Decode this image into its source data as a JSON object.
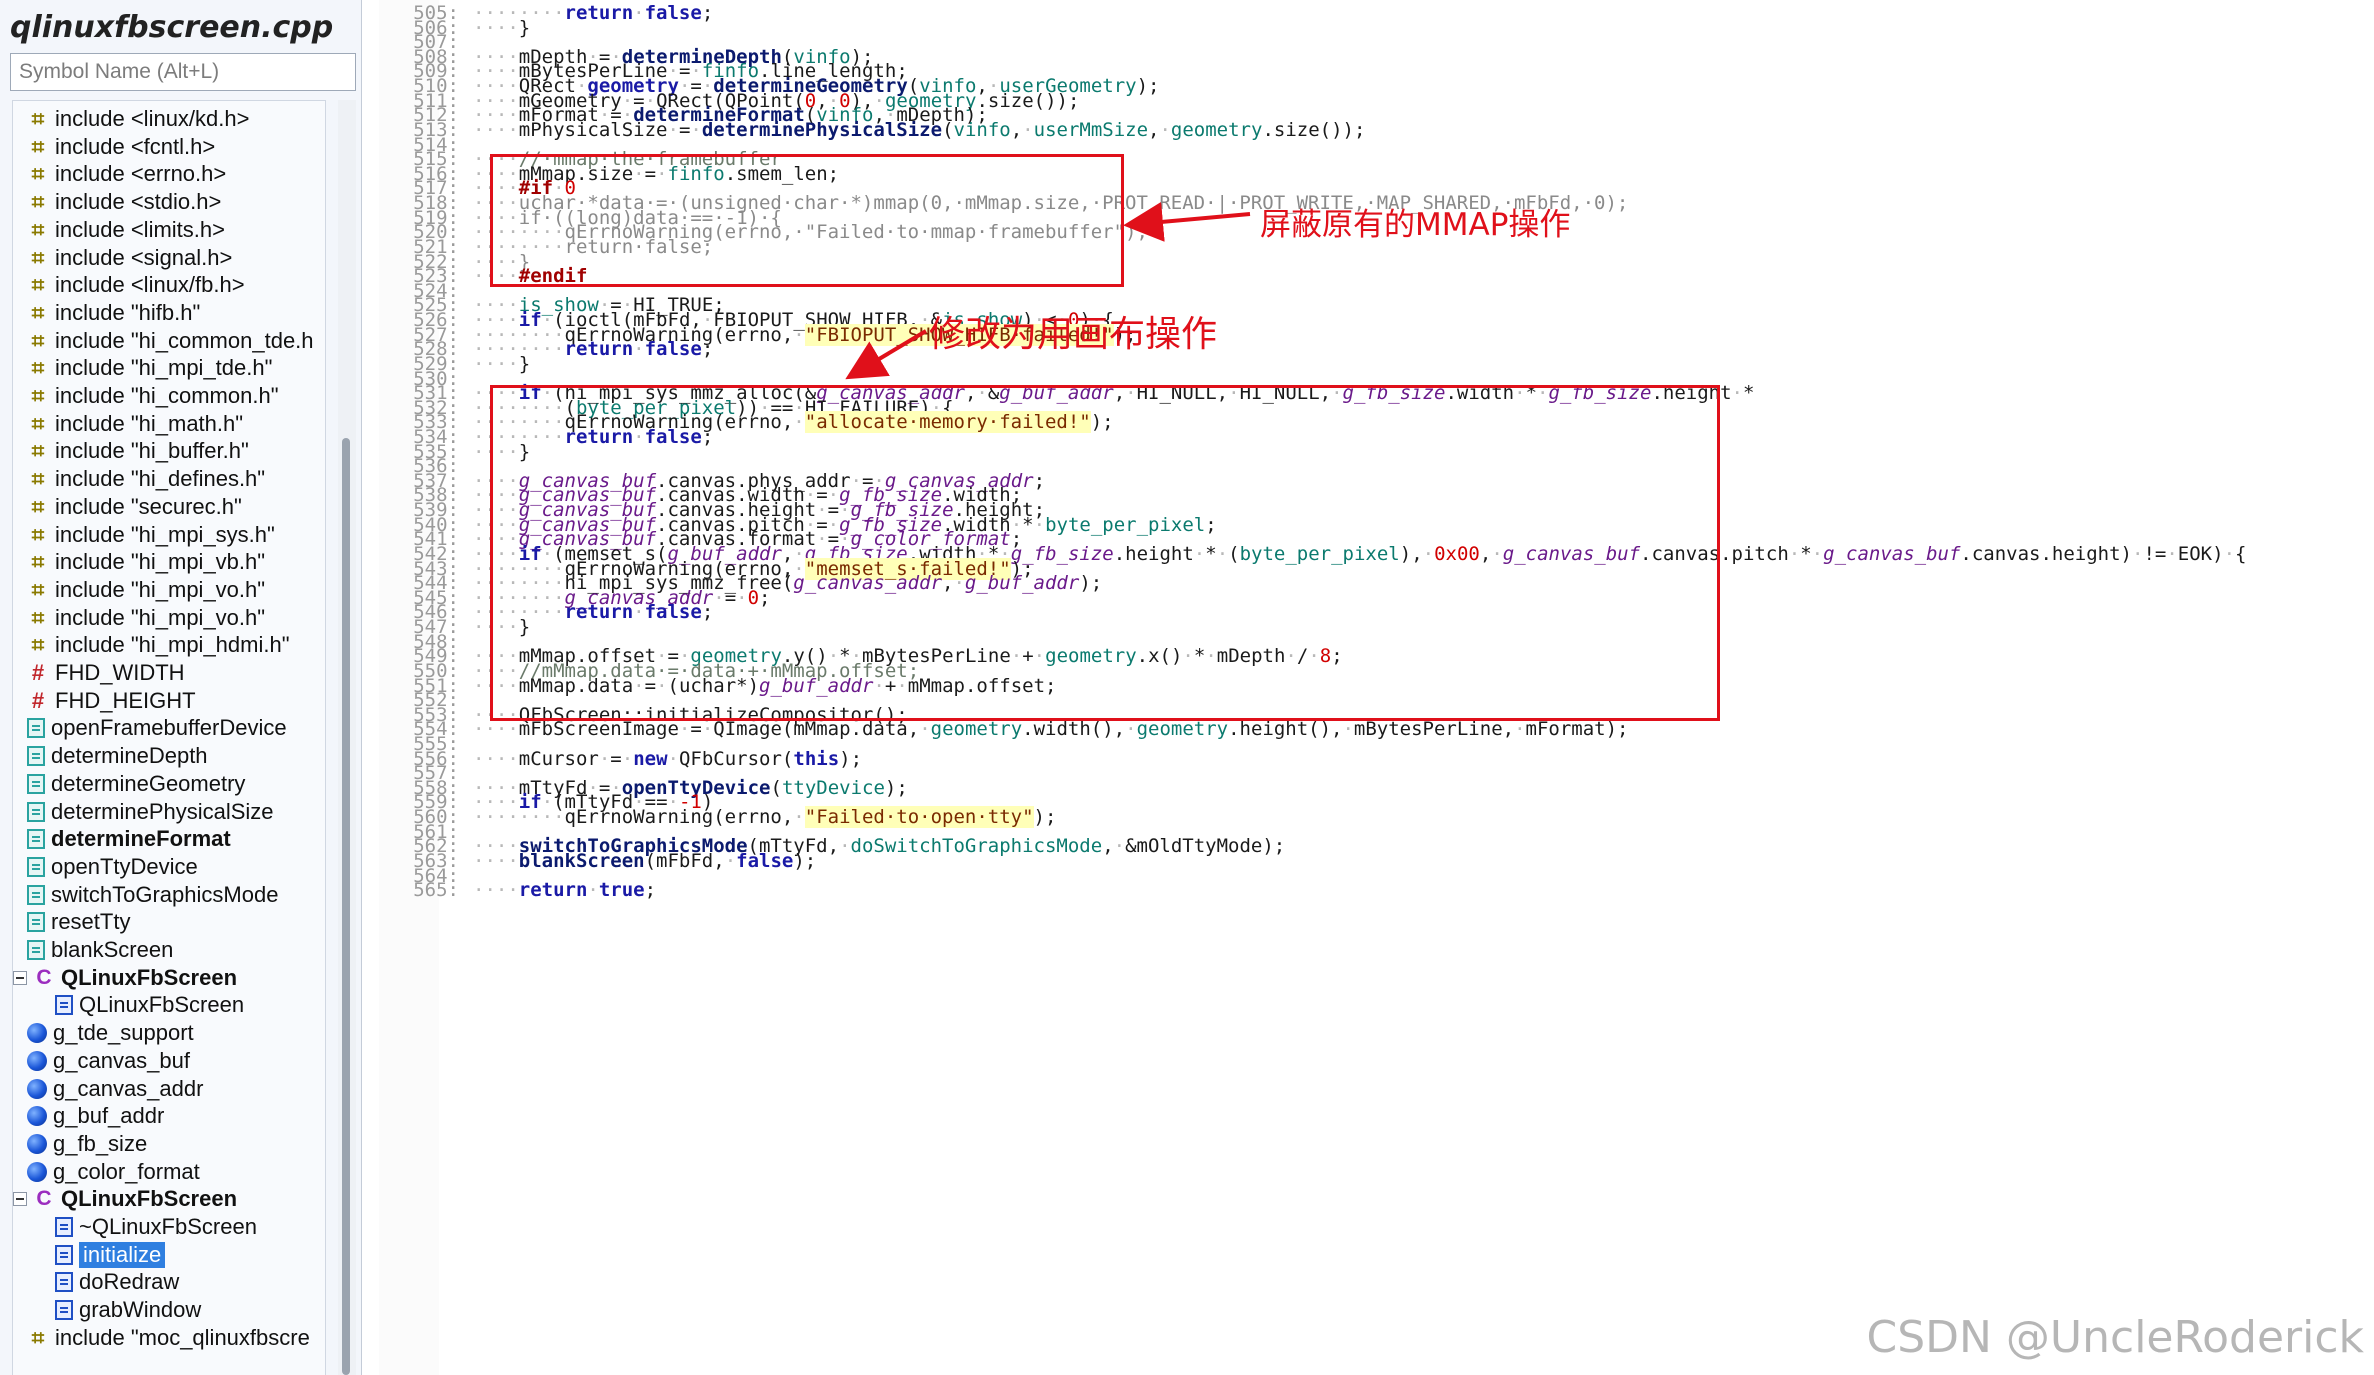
{
  "sidebar": {
    "file_title": "qlinuxfbscreen.cpp",
    "search_placeholder": "Symbol Name (Alt+L)",
    "items": [
      {
        "label": "include <linux/kd.h>",
        "kind": "include",
        "indent": 1
      },
      {
        "label": "include <fcntl.h>",
        "kind": "include",
        "indent": 1
      },
      {
        "label": "include <errno.h>",
        "kind": "include",
        "indent": 1
      },
      {
        "label": "include <stdio.h>",
        "kind": "include",
        "indent": 1
      },
      {
        "label": "include <limits.h>",
        "kind": "include",
        "indent": 1
      },
      {
        "label": "include <signal.h>",
        "kind": "include",
        "indent": 1
      },
      {
        "label": "include <linux/fb.h>",
        "kind": "include",
        "indent": 1
      },
      {
        "label": "include \"hifb.h\"",
        "kind": "include",
        "indent": 1
      },
      {
        "label": "include \"hi_common_tde.h",
        "kind": "include",
        "indent": 1
      },
      {
        "label": "include \"hi_mpi_tde.h\"",
        "kind": "include",
        "indent": 1
      },
      {
        "label": "include \"hi_common.h\"",
        "kind": "include",
        "indent": 1
      },
      {
        "label": "include \"hi_math.h\"",
        "kind": "include",
        "indent": 1
      },
      {
        "label": "include \"hi_buffer.h\"",
        "kind": "include",
        "indent": 1
      },
      {
        "label": "include \"hi_defines.h\"",
        "kind": "include",
        "indent": 1
      },
      {
        "label": "include \"securec.h\"",
        "kind": "include",
        "indent": 1
      },
      {
        "label": "include \"hi_mpi_sys.h\"",
        "kind": "include",
        "indent": 1
      },
      {
        "label": "include \"hi_mpi_vb.h\"",
        "kind": "include",
        "indent": 1
      },
      {
        "label": "include \"hi_mpi_vo.h\"",
        "kind": "include",
        "indent": 1
      },
      {
        "label": "include \"hi_mpi_vo.h\"",
        "kind": "include",
        "indent": 1
      },
      {
        "label": "include \"hi_mpi_hdmi.h\"",
        "kind": "include",
        "indent": 1
      },
      {
        "label": "FHD_WIDTH",
        "kind": "define",
        "indent": 1
      },
      {
        "label": "FHD_HEIGHT",
        "kind": "define",
        "indent": 1
      },
      {
        "label": "openFramebufferDevice",
        "kind": "func",
        "indent": 1
      },
      {
        "label": "determineDepth",
        "kind": "func",
        "indent": 1
      },
      {
        "label": "determineGeometry",
        "kind": "func",
        "indent": 1
      },
      {
        "label": "determinePhysicalSize",
        "kind": "func",
        "indent": 1
      },
      {
        "label": "determineFormat",
        "kind": "func",
        "indent": 1,
        "bold": true
      },
      {
        "label": "openTtyDevice",
        "kind": "func",
        "indent": 1
      },
      {
        "label": "switchToGraphicsMode",
        "kind": "func",
        "indent": 1
      },
      {
        "label": "resetTty",
        "kind": "func",
        "indent": 1
      },
      {
        "label": "blankScreen",
        "kind": "func",
        "indent": 1
      },
      {
        "label": "QLinuxFbScreen",
        "kind": "class",
        "indent": 0,
        "bold": true,
        "expander": true
      },
      {
        "label": "QLinuxFbScreen",
        "kind": "method",
        "indent": 2
      },
      {
        "label": "g_tde_support",
        "kind": "var",
        "indent": 1
      },
      {
        "label": "g_canvas_buf",
        "kind": "var",
        "indent": 1
      },
      {
        "label": "g_canvas_addr",
        "kind": "var",
        "indent": 1
      },
      {
        "label": "g_buf_addr",
        "kind": "var",
        "indent": 1
      },
      {
        "label": "g_fb_size",
        "kind": "var",
        "indent": 1
      },
      {
        "label": "g_color_format",
        "kind": "var",
        "indent": 1
      },
      {
        "label": "QLinuxFbScreen",
        "kind": "class",
        "indent": 0,
        "bold": true,
        "expander": true
      },
      {
        "label": "~QLinuxFbScreen",
        "kind": "method",
        "indent": 2
      },
      {
        "label": "initialize",
        "kind": "method",
        "indent": 2,
        "selected": true
      },
      {
        "label": "doRedraw",
        "kind": "method",
        "indent": 2
      },
      {
        "label": "grabWindow",
        "kind": "method",
        "indent": 2
      },
      {
        "label": "include \"moc_qlinuxfbscre",
        "kind": "include",
        "indent": 1
      }
    ]
  },
  "editor": {
    "lines": [
      {
        "n": "505:",
        "html": "<span class='ws'>········</span><span class='kw'>return</span><span class='ws'>·</span><span class='kw'>false</span>;"
      },
      {
        "n": "506:",
        "html": "<span class='ws'>····</span>}"
      },
      {
        "n": "507:",
        "html": ""
      },
      {
        "n": "508:",
        "html": "<span class='ws'>····</span>mDepth<span class='ws'>·</span>=<span class='ws'>·</span><span class='fnbold'>determineDepth</span>(<span class='fn'>vinfo</span>);"
      },
      {
        "n": "509:",
        "html": "<span class='ws'>····</span>mBytesPerLine<span class='ws'>·</span>=<span class='ws'>·</span><span class='fn'>finfo</span>.line_length;"
      },
      {
        "n": "510:",
        "html": "<span class='ws'>····</span>QRect<span class='ws'>·</span><span class='kw'>geometry</span><span class='ws'>·</span>=<span class='ws'>·</span><span class='fnbold'>determineGeometry</span>(<span class='fn'>vinfo</span>,<span class='ws'>·</span><span class='fn'>userGeometry</span>);"
      },
      {
        "n": "511:",
        "html": "<span class='ws'>····</span>mGeometry<span class='ws'>·</span>=<span class='ws'>·</span>QRect(QPoint(<span class='num'>0</span>,<span class='ws'>·</span><span class='num'>0</span>),<span class='ws'>·</span><span class='fn'>geometry</span>.size());"
      },
      {
        "n": "512:",
        "html": "<span class='ws'>····</span>mFormat<span class='ws'>·</span>=<span class='ws'>·</span><span class='fnbold'>determineFormat</span>(<span class='fn'>vinfo</span>,<span class='ws'>·</span>mDepth);"
      },
      {
        "n": "513:",
        "html": "<span class='ws'>····</span>mPhysicalSize<span class='ws'>·</span>=<span class='ws'>·</span><span class='fnbold'>determinePhysicalSize</span>(<span class='fn'>vinfo</span>,<span class='ws'>·</span><span class='fn'>userMmSize</span>,<span class='ws'>·</span><span class='fn'>geometry</span>.size());"
      },
      {
        "n": "514:",
        "html": ""
      },
      {
        "n": "515:",
        "html": "<span class='ws'>····</span><span class='cm'>//·mmap·the·framebuffer</span>"
      },
      {
        "n": "516:",
        "html": "<span class='ws'>····</span>mMmap.size<span class='ws'>·</span>=<span class='ws'>·</span><span class='fn'>finfo</span>.smem_len;"
      },
      {
        "n": "517:",
        "html": "<span class='ws'>····</span><span class='pp'>#if</span><span class='ws'>·</span><span class='num'>0</span>"
      },
      {
        "n": "518:",
        "html": "<span class='ws'>····</span><span class='gray'>uchar·*data·=·(unsigned·char·*)mmap(0,·mMmap.size,·PROT_READ·|·PROT_WRITE,·MAP_SHARED,·mFbFd,·0);</span>"
      },
      {
        "n": "519:",
        "html": "<span class='ws'>····</span><span class='gray'>if·((long)data·==·-1)·{</span>"
      },
      {
        "n": "520:",
        "html": "<span class='ws'>········</span><span class='gray'>qErrnoWarning(errno,·\"Failed·to·mmap·framebuffer\");</span>"
      },
      {
        "n": "521:",
        "html": "<span class='ws'>········</span><span class='gray'>return·false;</span>"
      },
      {
        "n": "522:",
        "html": "<span class='ws'>····</span><span class='gray'>}</span>"
      },
      {
        "n": "523:",
        "html": "<span class='ws'>····</span><span class='pp'>#endif</span>"
      },
      {
        "n": "524:",
        "html": ""
      },
      {
        "n": "525:",
        "html": "<span class='ws'>····</span><span class='fn'>is_show</span><span class='ws'>·</span>=<span class='ws'>·</span>HI_TRUE;"
      },
      {
        "n": "526:",
        "html": "<span class='ws'>····</span><span class='kw'>if</span><span class='ws'>·</span>(ioctl(mFbFd,<span class='ws'>·</span>FBIOPUT_SHOW_HIFB,<span class='ws'>·</span>&amp;<span class='fn'>is_show</span>)<span class='ws'>·</span>&lt;<span class='ws'>·</span><span class='num'>0</span>)<span class='ws'>·</span>{"
      },
      {
        "n": "527:",
        "html": "<span class='ws'>········</span>qErrnoWarning(errno,<span class='ws'>·</span><span class='str'>\"FBIOPUT_SHOW_HIFB·failed!\"</span>);"
      },
      {
        "n": "528:",
        "html": "<span class='ws'>········</span><span class='kw'>return</span><span class='ws'>·</span><span class='kw'>false</span>;"
      },
      {
        "n": "529:",
        "html": "<span class='ws'>····</span>}"
      },
      {
        "n": "530:",
        "html": ""
      },
      {
        "n": "531:",
        "html": "<span class='ws'>····</span><span class='kw'>if</span><span class='ws'>·</span>(hi_mpi_sys_mmz_alloc(&amp;<span class='gv'>g_canvas_addr</span>,<span class='ws'>·</span>&amp;<span class='gv'>g_buf_addr</span>,<span class='ws'>·</span>HI_NULL,<span class='ws'>·</span>HI_NULL,<span class='ws'>·</span><span class='gv'>g_fb_size</span>.width<span class='ws'>·</span>*<span class='ws'>·</span><span class='gv'>g_fb_size</span>.height<span class='ws'>·</span>*"
      },
      {
        "n": "532:",
        "html": "<span class='ws'>········</span>(<span class='fn'>byte_per_pixel</span>))<span class='ws'>·</span>==<span class='ws'>·</span>HI_FAILURE)<span class='ws'>·</span>{"
      },
      {
        "n": "533:",
        "html": "<span class='ws'>········</span>qErrnoWarning(errno,<span class='ws'>·</span><span class='str'>\"allocate·memory·failed!\"</span>);"
      },
      {
        "n": "534:",
        "html": "<span class='ws'>········</span><span class='kw'>return</span><span class='ws'>·</span><span class='kw'>false</span>;"
      },
      {
        "n": "535:",
        "html": "<span class='ws'>····</span>}"
      },
      {
        "n": "536:",
        "html": ""
      },
      {
        "n": "537:",
        "html": "<span class='ws'>····</span><span class='gv'>g_canvas_buf</span>.canvas.phys_addr<span class='ws'>·</span>=<span class='ws'>·</span><span class='gv'>g_canvas_addr</span>;"
      },
      {
        "n": "538:",
        "html": "<span class='ws'>····</span><span class='gv'>g_canvas_buf</span>.canvas.width<span class='ws'>·</span>=<span class='ws'>·</span><span class='gv'>g_fb_size</span>.width;"
      },
      {
        "n": "539:",
        "html": "<span class='ws'>····</span><span class='gv'>g_canvas_buf</span>.canvas.height<span class='ws'>·</span>=<span class='ws'>·</span><span class='gv'>g_fb_size</span>.height;"
      },
      {
        "n": "540:",
        "html": "<span class='ws'>····</span><span class='gv'>g_canvas_buf</span>.canvas.pitch<span class='ws'>·</span>=<span class='ws'>·</span><span class='gv'>g_fb_size</span>.width<span class='ws'>·</span>*<span class='ws'>·</span><span class='fn'>byte_per_pixel</span>;"
      },
      {
        "n": "541:",
        "html": "<span class='ws'>····</span><span class='gv'>g_canvas_buf</span>.canvas.format<span class='ws'>·</span>=<span class='ws'>·</span><span class='gv'>g_color_format</span>;"
      },
      {
        "n": "542:",
        "html": "<span class='ws'>····</span><span class='kw'>if</span><span class='ws'>·</span>(memset_s(<span class='gv'>g_buf_addr</span>,<span class='ws'>·</span><span class='gv'>g_fb_size</span>.width<span class='ws'>·</span>*<span class='ws'>·</span><span class='gv'>g_fb_size</span>.height<span class='ws'>·</span>*<span class='ws'>·</span>(<span class='fn'>byte_per_pixel</span>),<span class='ws'>·</span><span class='num'>0x00</span>,<span class='ws'>·</span><span class='gv'>g_canvas_buf</span>.canvas.pitch<span class='ws'>·</span>*<span class='ws'>·</span><span class='gv'>g_canvas_buf</span>.canvas.height)<span class='ws'>·</span>!=<span class='ws'>·</span>EOK)<span class='ws'>·</span>{"
      },
      {
        "n": "543:",
        "html": "<span class='ws'>········</span>qErrnoWarning(errno,<span class='ws'>·</span><span class='str'>\"memset_s·failed!\"</span>);"
      },
      {
        "n": "544:",
        "html": "<span class='ws'>········</span>hi_mpi_sys_mmz_free(<span class='gv'>g_canvas_addr</span>,<span class='ws'>·</span><span class='gv'>g_buf_addr</span>);"
      },
      {
        "n": "545:",
        "html": "<span class='ws'>········</span><span class='gv'>g_canvas_addr</span><span class='ws'>·</span>=<span class='ws'>·</span><span class='num'>0</span>;"
      },
      {
        "n": "546:",
        "html": "<span class='ws'>········</span><span class='kw'>return</span><span class='ws'>·</span><span class='kw'>false</span>;"
      },
      {
        "n": "547:",
        "html": "<span class='ws'>····</span>}"
      },
      {
        "n": "548:",
        "html": ""
      },
      {
        "n": "549:",
        "html": "<span class='ws'>····</span>mMmap.offset<span class='ws'>·</span>=<span class='ws'>·</span><span class='fn'>geometry</span>.y()<span class='ws'>·</span>*<span class='ws'>·</span>mBytesPerLine<span class='ws'>·</span>+<span class='ws'>·</span><span class='fn'>geometry</span>.x()<span class='ws'>·</span>*<span class='ws'>·</span>mDepth<span class='ws'>·</span>/<span class='ws'>·</span><span class='num'>8</span>;"
      },
      {
        "n": "550:",
        "html": "<span class='ws'>····</span><span class='cm'>//mMmap.data·=·data·+·mMmap.offset;</span>"
      },
      {
        "n": "551:",
        "html": "<span class='ws'>····</span>mMmap.data<span class='ws'>·</span>=<span class='ws'>·</span>(uchar*)<span class='gv'>g_buf_addr</span><span class='ws'>·</span>+<span class='ws'>·</span>mMmap.offset;"
      },
      {
        "n": "552:",
        "html": ""
      },
      {
        "n": "553:",
        "html": "<span class='ws'>····</span>QFbScreen::initializeCompositor();"
      },
      {
        "n": "554:",
        "html": "<span class='ws'>····</span>mFbScreenImage<span class='ws'>·</span>=<span class='ws'>·</span>QImage(mMmap.data,<span class='ws'>·</span><span class='fn'>geometry</span>.width(),<span class='ws'>·</span><span class='fn'>geometry</span>.height(),<span class='ws'>·</span>mBytesPerLine,<span class='ws'>·</span>mFormat);"
      },
      {
        "n": "555:",
        "html": ""
      },
      {
        "n": "556:",
        "html": "<span class='ws'>····</span>mCursor<span class='ws'>·</span>=<span class='ws'>·</span><span class='kw'>new</span><span class='ws'>·</span>QFbCursor(<span class='kw'>this</span>);"
      },
      {
        "n": "557:",
        "html": ""
      },
      {
        "n": "558:",
        "html": "<span class='ws'>····</span>mTtyFd<span class='ws'>·</span>=<span class='ws'>·</span><span class='fnbold'>openTtyDevice</span>(<span class='fn'>ttyDevice</span>);"
      },
      {
        "n": "559:",
        "html": "<span class='ws'>····</span><span class='kw'>if</span><span class='ws'>·</span>(mTtyFd<span class='ws'>·</span>==<span class='ws'>·</span><span class='num'>-1</span>)"
      },
      {
        "n": "560:",
        "html": "<span class='ws'>········</span>qErrnoWarning(errno,<span class='ws'>·</span><span class='str'>\"Failed·to·open·tty\"</span>);"
      },
      {
        "n": "561:",
        "html": ""
      },
      {
        "n": "562:",
        "html": "<span class='ws'>····</span><span class='fnbold'>switchToGraphicsMode</span>(mTtyFd,<span class='ws'>·</span><span class='fn'>doSwitchToGraphicsMode</span>,<span class='ws'>·</span>&amp;mOldTtyMode);"
      },
      {
        "n": "563:",
        "html": "<span class='ws'>····</span><span class='fnbold'>blankScreen</span>(mFbFd,<span class='ws'>·</span><span class='kw'>false</span>);"
      },
      {
        "n": "564:",
        "html": ""
      },
      {
        "n": "565:",
        "html": "<span class='ws'>····</span><span class='kw'>return</span><span class='ws'>·</span><span class='kw'>true</span>;"
      }
    ]
  },
  "annotations": {
    "mmap_note": "屏蔽原有的MMAP操作",
    "canvas_note": "修改为用画布操作",
    "color": "#e0101a"
  },
  "watermark": "CSDN @UncleRoderick"
}
